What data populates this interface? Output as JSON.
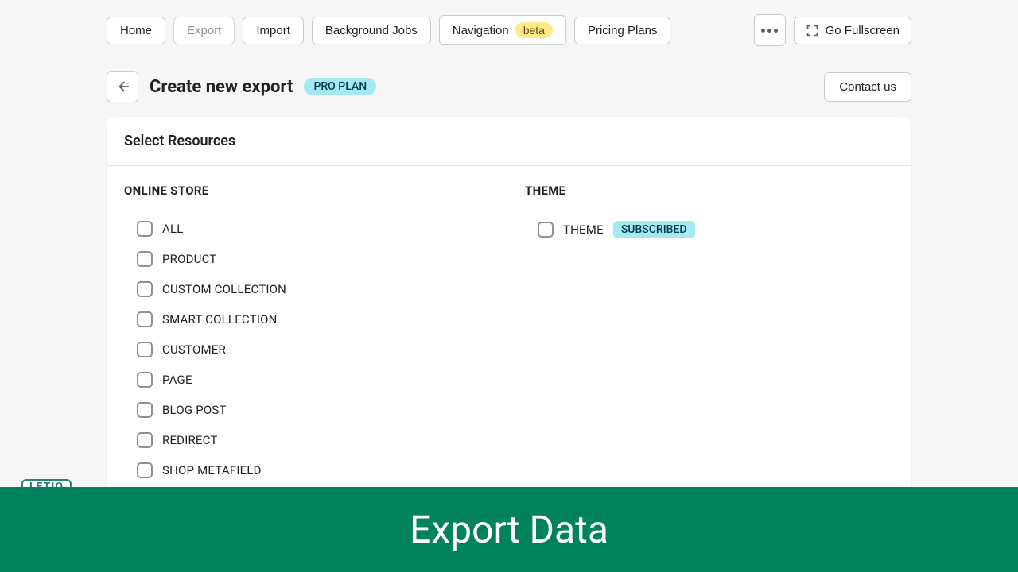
{
  "nav": {
    "home": "Home",
    "export": "Export",
    "import": "Import",
    "background_jobs": "Background Jobs",
    "navigation": "Navigation",
    "navigation_badge": "beta",
    "pricing_plans": "Pricing Plans",
    "go_fullscreen": "Go Fullscreen"
  },
  "header": {
    "title": "Create new export",
    "plan_badge": "PRO PLAN",
    "contact": "Contact us"
  },
  "card": {
    "title": "Select Resources",
    "online_store_heading": "ONLINE STORE",
    "theme_heading": "THEME",
    "online_store_items": {
      "all": "ALL",
      "product": "PRODUCT",
      "custom_collection": "CUSTOM COLLECTION",
      "smart_collection": "SMART COLLECTION",
      "customer": "CUSTOMER",
      "page": "PAGE",
      "blog_post": "BLOG POST",
      "redirect": "REDIRECT",
      "shop_metafield": "SHOP METAFIELD"
    },
    "theme_items": {
      "theme": "THEME",
      "theme_badge": "SUBSCRIBED"
    }
  },
  "logo": "LETIO",
  "banner": "Export Data"
}
